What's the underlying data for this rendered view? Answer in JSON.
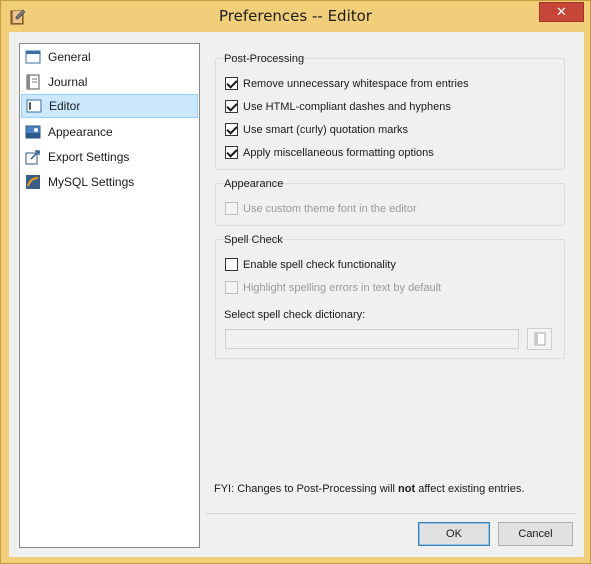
{
  "window": {
    "title": "Preferences -- Editor",
    "close_label": "✕"
  },
  "sidebar": {
    "items": [
      {
        "label": "General",
        "icon": "window-icon"
      },
      {
        "label": "Journal",
        "icon": "journal-icon"
      },
      {
        "label": "Editor",
        "icon": "editor-icon",
        "selected": true
      },
      {
        "label": "Appearance",
        "icon": "appearance-icon"
      },
      {
        "label": "Export Settings",
        "icon": "export-icon"
      },
      {
        "label": "MySQL Settings",
        "icon": "mysql-icon"
      }
    ]
  },
  "post_processing": {
    "title": "Post-Processing",
    "options": [
      {
        "label": "Remove unnecessary whitespace from entries",
        "checked": true
      },
      {
        "label": "Use HTML-compliant dashes and hyphens",
        "checked": true
      },
      {
        "label": "Use smart (curly) quotation marks",
        "checked": true
      },
      {
        "label": "Apply miscellaneous formatting options",
        "checked": true
      }
    ]
  },
  "appearance": {
    "title": "Appearance",
    "options": [
      {
        "label": "Use custom theme font in the editor",
        "checked": false,
        "disabled": true
      }
    ]
  },
  "spell_check": {
    "title": "Spell Check",
    "options": [
      {
        "label": "Enable spell check functionality",
        "checked": false,
        "disabled": false
      },
      {
        "label": "Highlight spelling errors in text by default",
        "checked": false,
        "disabled": true
      }
    ],
    "dictionary_label": "Select spell check dictionary:",
    "dictionary_value": ""
  },
  "footer": {
    "fyi_prefix": "FYI: Changes to Post-Processing will ",
    "fyi_bold": "not",
    "fyi_suffix": " affect existing entries.",
    "ok_label": "OK",
    "cancel_label": "Cancel"
  },
  "colors": {
    "frame": "#f1ce7a",
    "close": "#c7463a",
    "selection": "#cce8ff"
  }
}
